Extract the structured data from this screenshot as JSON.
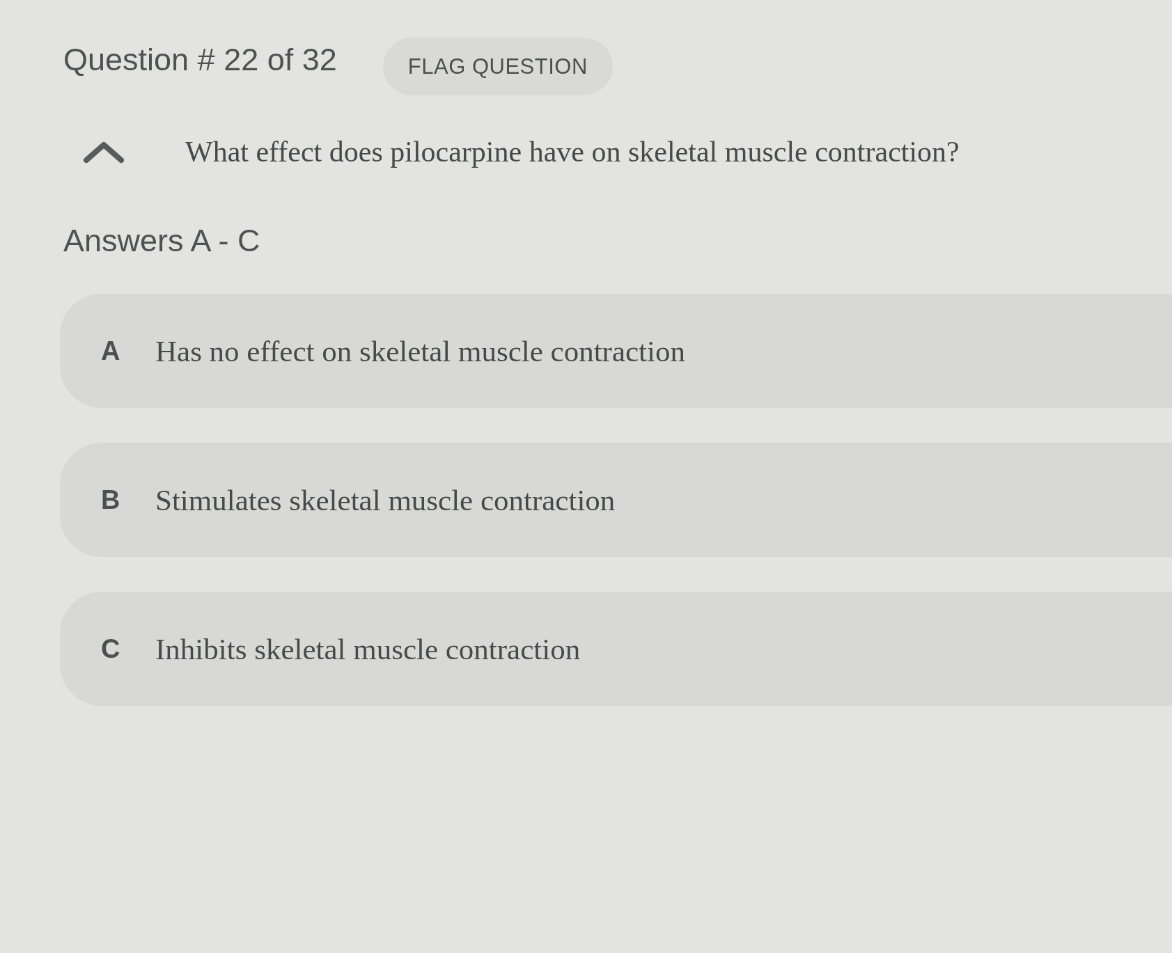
{
  "header": {
    "question_counter": "Question # 22 of 32",
    "flag_button": "FLAG QUESTION"
  },
  "question": {
    "expanded": true,
    "text": "What effect does pilocarpine have on skeletal muscle contraction?"
  },
  "answers_heading": "Answers A - C",
  "answers": [
    {
      "letter": "A",
      "text": "Has no effect on skeletal muscle contraction"
    },
    {
      "letter": "B",
      "text": "Stimulates skeletal muscle contraction"
    },
    {
      "letter": "C",
      "text": "Inhibits skeletal muscle contraction"
    }
  ]
}
